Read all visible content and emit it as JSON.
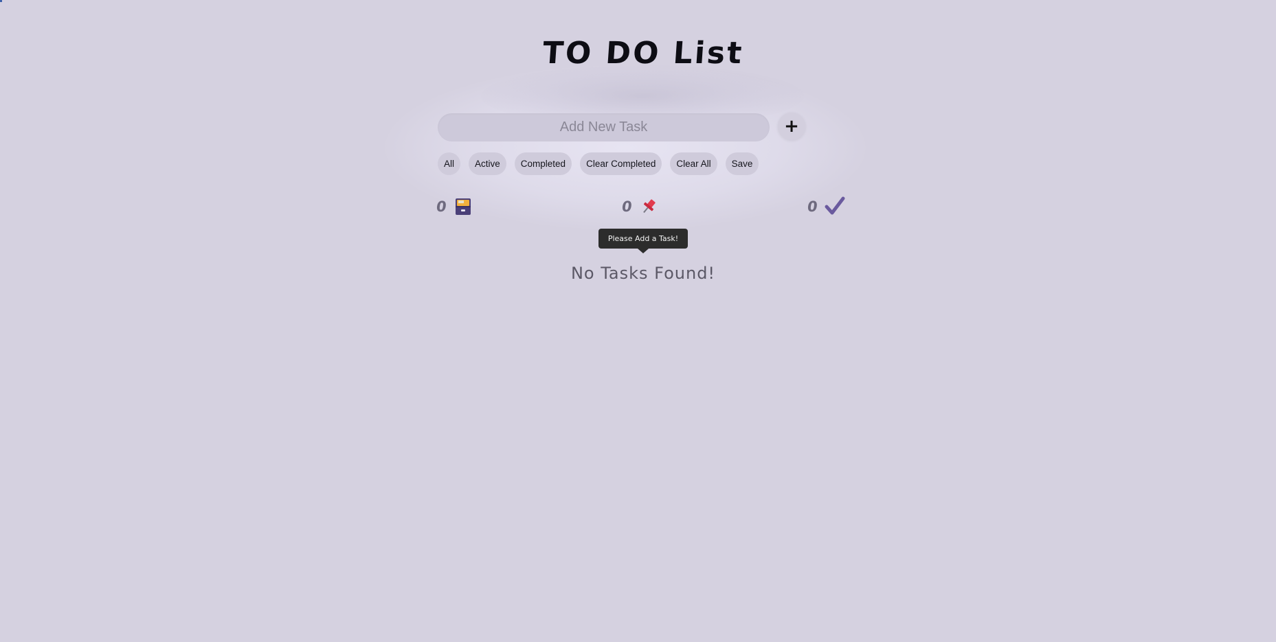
{
  "app": {
    "title": "TO DO List"
  },
  "input": {
    "placeholder": "Add New Task",
    "value": "",
    "add_label": "+"
  },
  "filters": {
    "all": "All",
    "active": "Active",
    "completed": "Completed",
    "clear_completed": "Clear Completed",
    "clear_all": "Clear All",
    "save": "Save"
  },
  "stats": {
    "total": {
      "count": "0",
      "icon": "file-cabinet-icon"
    },
    "pending": {
      "count": "0",
      "icon": "pushpin-icon"
    },
    "done": {
      "count": "0",
      "icon": "checkmark-icon"
    }
  },
  "tooltip": {
    "text": "Please Add a Task!"
  },
  "empty": {
    "text": "No Tasks Found!"
  },
  "colors": {
    "background": "#d5d1e0",
    "accent": "#6a5a9e",
    "pin": "#e23b4e",
    "tooltip": "#2c2c2c"
  }
}
